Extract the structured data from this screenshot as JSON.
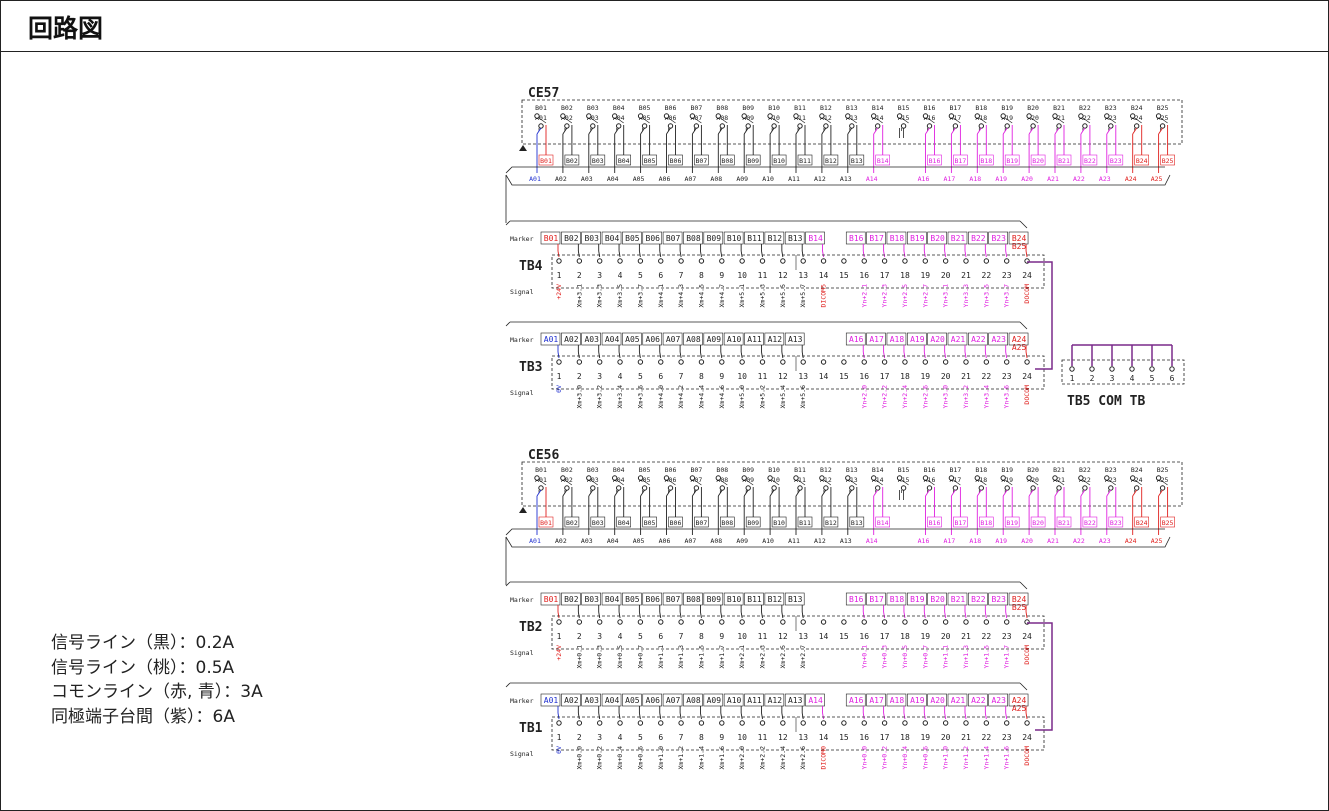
{
  "title": "回路図",
  "legend": [
    "信号ライン（黒）：0.2A",
    "信号ライン（桃）：0.5A",
    "コモンライン（赤, 青）：3A",
    "同極端子台間（紫）：6A"
  ],
  "colors": {
    "black": "#222222",
    "pink": "#e020e0",
    "red": "#e0201e",
    "blue": "#2030d0",
    "purple": "#7a2a8a"
  },
  "connectors": [
    {
      "name": "CE57",
      "b_pins": [
        "B01",
        "B02",
        "B03",
        "B04",
        "B05",
        "B06",
        "B07",
        "B08",
        "B09",
        "B10",
        "B11",
        "B12",
        "B13",
        "B14",
        "B15",
        "B16",
        "B17",
        "B18",
        "B19",
        "B20",
        "B21",
        "B22",
        "B23",
        "B24",
        "B25"
      ],
      "a_pins": [
        "A01",
        "A02",
        "A03",
        "A04",
        "A05",
        "A06",
        "A07",
        "A08",
        "A09",
        "A10",
        "A11",
        "A12",
        "A13",
        "A14",
        "A15",
        "A16",
        "A17",
        "A18",
        "A19",
        "A20",
        "A21",
        "A22",
        "A23",
        "A24",
        "A25"
      ]
    },
    {
      "name": "CE56",
      "b_pins": [
        "B01",
        "B02",
        "B03",
        "B04",
        "B05",
        "B06",
        "B07",
        "B08",
        "B09",
        "B10",
        "B11",
        "B12",
        "B13",
        "B14",
        "B15",
        "B16",
        "B17",
        "B18",
        "B19",
        "B20",
        "B21",
        "B22",
        "B23",
        "B24",
        "B25"
      ],
      "a_pins": [
        "A01",
        "A02",
        "A03",
        "A04",
        "A05",
        "A06",
        "A07",
        "A08",
        "A09",
        "A10",
        "A11",
        "A12",
        "A13",
        "A14",
        "A15",
        "A16",
        "A17",
        "A18",
        "A19",
        "A20",
        "A21",
        "A22",
        "A23",
        "A24",
        "A25"
      ]
    }
  ],
  "terminal_blocks": [
    {
      "name": "TB4",
      "marker_label": "Marker",
      "signal_label": "Signal",
      "markers": [
        "B01",
        "B02",
        "B03",
        "B04",
        "B05",
        "B06",
        "B07",
        "B08",
        "B09",
        "B10",
        "B11",
        "B12",
        "B13",
        "B14",
        "",
        "B16",
        "B17",
        "B18",
        "B19",
        "B20",
        "B21",
        "B22",
        "B23",
        "B24 B25"
      ],
      "terminals": [
        "1",
        "2",
        "3",
        "4",
        "5",
        "6",
        "7",
        "8",
        "9",
        "10",
        "11",
        "12",
        "13",
        "14",
        "15",
        "16",
        "17",
        "18",
        "19",
        "20",
        "21",
        "22",
        "23",
        "24"
      ],
      "signals": [
        "+24V",
        "Xm+3.1",
        "Xm+3.3",
        "Xm+3.5",
        "Xm+3.7",
        "Xm+4.1",
        "Xm+4.3",
        "Xm+4.5",
        "Xm+4.7",
        "Xm+5.1",
        "Xm+5.3",
        "Xm+5.5",
        "Xm+5.7",
        "DICOM5",
        "",
        "Yn+2.1",
        "Yn+2.3",
        "Yn+2.5",
        "Yn+2.7",
        "Yn+3.1",
        "Yn+3.3",
        "Yn+3.5",
        "Yn+3.7",
        "DOCOM"
      ]
    },
    {
      "name": "TB3",
      "marker_label": "Marker",
      "signal_label": "Signal",
      "markers": [
        "A01",
        "A02",
        "A03",
        "A04",
        "A05",
        "A06",
        "A07",
        "A08",
        "A09",
        "A10",
        "A11",
        "A12",
        "A13",
        "",
        "",
        "A16",
        "A17",
        "A18",
        "A19",
        "A20",
        "A21",
        "A22",
        "A23",
        "A24 A25"
      ],
      "terminals": [
        "1",
        "2",
        "3",
        "4",
        "5",
        "6",
        "7",
        "8",
        "9",
        "10",
        "11",
        "12",
        "13",
        "14",
        "15",
        "16",
        "17",
        "18",
        "19",
        "20",
        "21",
        "22",
        "23",
        "24"
      ],
      "signals": [
        "0V",
        "Xm+3.0",
        "Xm+3.2",
        "Xm+3.4",
        "Xm+3.6",
        "Xm+4.0",
        "Xm+4.2",
        "Xm+4.4",
        "Xm+4.6",
        "Xm+5.0",
        "Xm+5.2",
        "Xm+5.4",
        "Xm+5.6",
        "",
        "",
        "Yn+2.0",
        "Yn+2.2",
        "Yn+2.4",
        "Yn+2.6",
        "Yn+3.0",
        "Yn+3.2",
        "Yn+3.4",
        "Yn+3.6",
        "DOCOM"
      ]
    },
    {
      "name": "TB2",
      "marker_label": "Marker",
      "signal_label": "Signal",
      "markers": [
        "B01",
        "B02",
        "B03",
        "B04",
        "B05",
        "B06",
        "B07",
        "B08",
        "B09",
        "B10",
        "B11",
        "B12",
        "B13",
        "",
        "",
        "B16",
        "B17",
        "B18",
        "B19",
        "B20",
        "B21",
        "B22",
        "B23",
        "B24 B25"
      ],
      "terminals": [
        "1",
        "2",
        "3",
        "4",
        "5",
        "6",
        "7",
        "8",
        "9",
        "10",
        "11",
        "12",
        "13",
        "14",
        "15",
        "16",
        "17",
        "18",
        "19",
        "20",
        "21",
        "22",
        "23",
        "24"
      ],
      "signals": [
        "+24V",
        "Xm+0.1",
        "Xm+0.3",
        "Xm+0.5",
        "Xm+0.7",
        "Xm+1.1",
        "Xm+1.3",
        "Xm+1.5",
        "Xm+1.7",
        "Xm+2.1",
        "Xm+2.3",
        "Xm+2.5",
        "Xm+2.7",
        "",
        "",
        "Yn+0.1",
        "Yn+0.3",
        "Yn+0.5",
        "Yn+0.7",
        "Yn+1.1",
        "Yn+1.3",
        "Yn+1.5",
        "Yn+1.7",
        "DOCOM"
      ]
    },
    {
      "name": "TB1",
      "marker_label": "Marker",
      "signal_label": "Signal",
      "markers": [
        "A01",
        "A02",
        "A03",
        "A04",
        "A05",
        "A06",
        "A07",
        "A08",
        "A09",
        "A10",
        "A11",
        "A12",
        "A13",
        "A14",
        "",
        "A16",
        "A17",
        "A18",
        "A19",
        "A20",
        "A21",
        "A22",
        "A23",
        "A24 A25"
      ],
      "terminals": [
        "1",
        "2",
        "3",
        "4",
        "5",
        "6",
        "7",
        "8",
        "9",
        "10",
        "11",
        "12",
        "13",
        "14",
        "15",
        "16",
        "17",
        "18",
        "19",
        "20",
        "21",
        "22",
        "23",
        "24"
      ],
      "signals": [
        "0V",
        "Xm+0.0",
        "Xm+0.2",
        "Xm+0.4",
        "Xm+0.6",
        "Xm+1.0",
        "Xm+1.2",
        "Xm+1.4",
        "Xm+1.6",
        "Xm+2.0",
        "Xm+2.2",
        "Xm+2.4",
        "Xm+2.6",
        "DICOM0",
        "",
        "Yn+0.0",
        "Yn+0.2",
        "Yn+0.4",
        "Yn+0.6",
        "Yn+1.0",
        "Yn+1.2",
        "Yn+1.4",
        "Yn+1.6",
        "DOCOM"
      ]
    }
  ],
  "common_tb": {
    "name": "TB5 COM TB",
    "terminals": [
      "1",
      "2",
      "3",
      "4",
      "5",
      "6"
    ]
  }
}
